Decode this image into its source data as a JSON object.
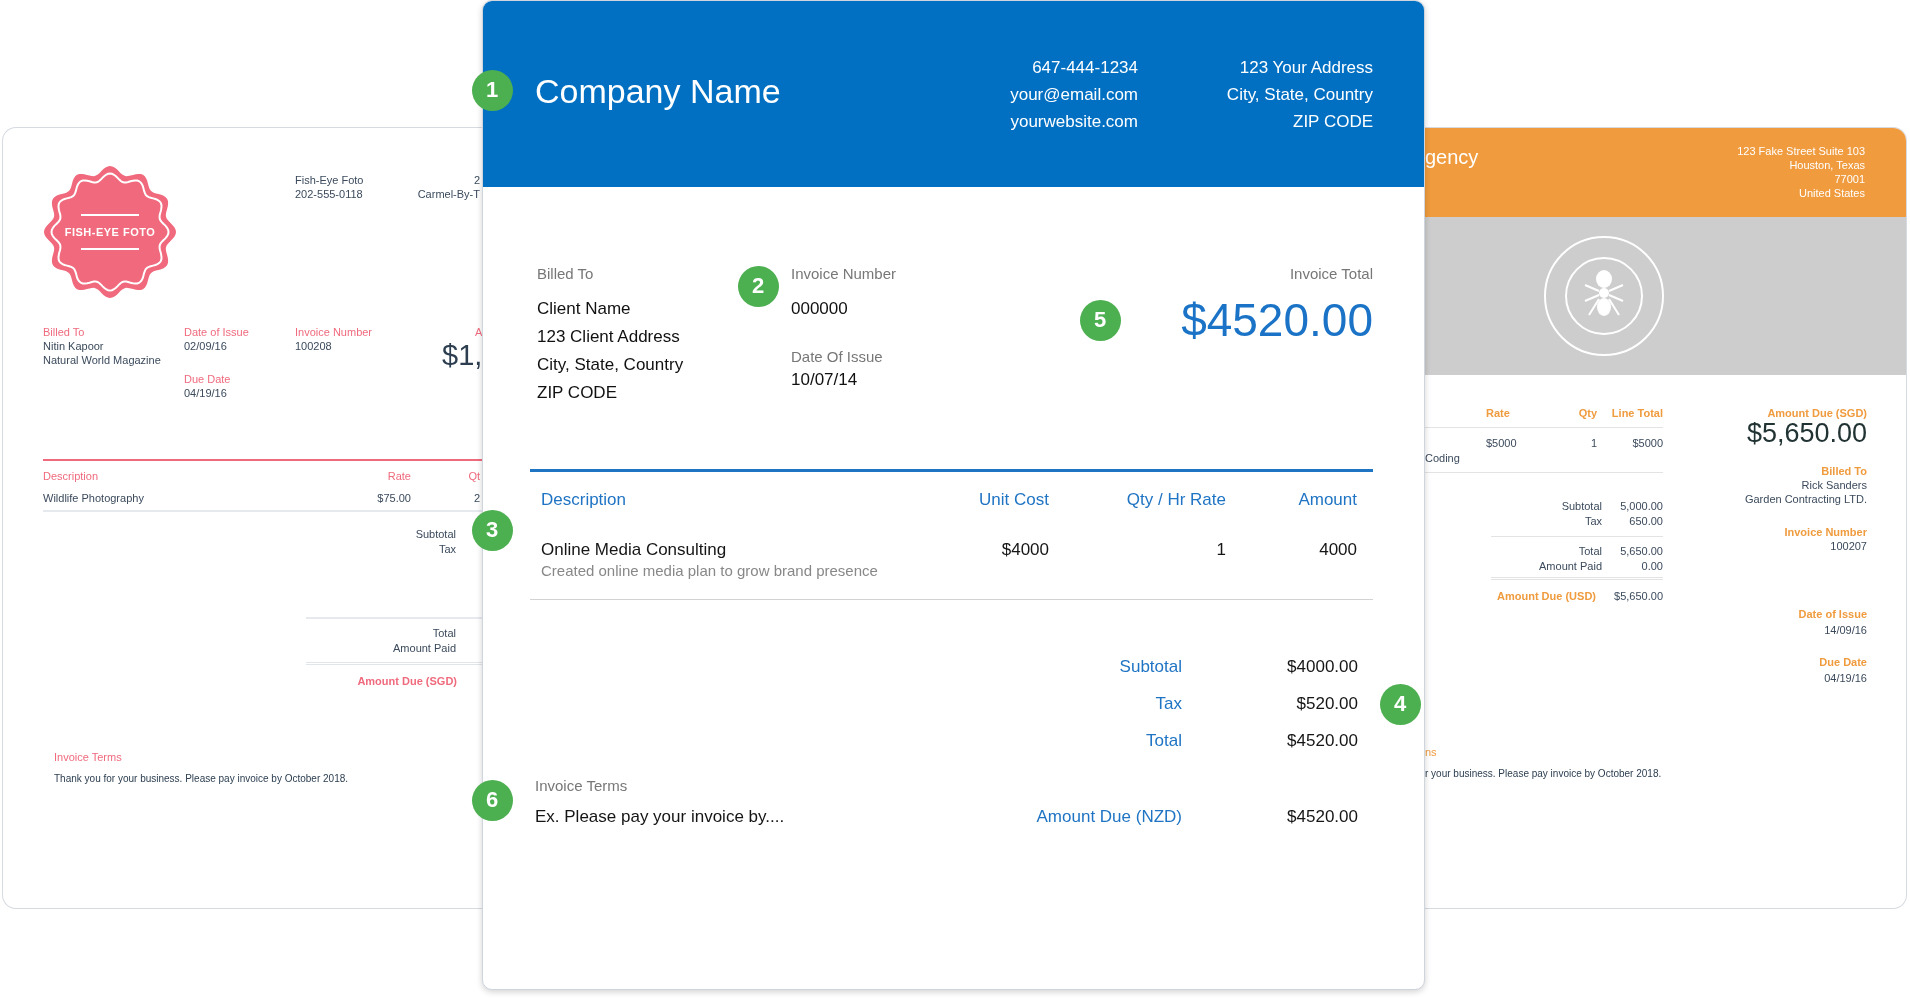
{
  "left_invoice": {
    "logo_text": "FISH-EYE FOTO",
    "contact": [
      "Fish-Eye Foto",
      "202-555-0118"
    ],
    "address": [
      "2",
      "Carmel-By-T"
    ],
    "billed_to": {
      "label": "Billed To",
      "lines": [
        "Nitin Kapoor",
        "Natural World Magazine"
      ]
    },
    "dates": [
      {
        "label": "Date of Issue",
        "value": "02/09/16"
      },
      {
        "label": "Due Date",
        "value": "04/19/16"
      }
    ],
    "invoice_number": {
      "label": "Invoice Number",
      "value": "100208"
    },
    "amount": {
      "label": "A",
      "value": "$1,"
    },
    "columns": [
      "Description",
      "Rate",
      "Qt"
    ],
    "rows": [
      [
        "Wildlife Photography",
        "$75.00",
        "2"
      ]
    ],
    "subtotals": [
      "Subtotal",
      "Tax"
    ],
    "totals": [
      "Total",
      "Amount Paid"
    ],
    "amount_due": "Amount Due (SGD)",
    "terms": {
      "label": "Invoice Terms",
      "text": "Thank you for your business. Please pay invoice by October 2018."
    }
  },
  "main_invoice": {
    "header": {
      "company": "Company Name",
      "contact": [
        "647-444-1234",
        "your@email.com",
        "yourwebsite.com"
      ],
      "address": [
        "123 Your Address",
        "City, State, Country",
        "ZIP CODE"
      ],
      "callout": "1"
    },
    "billed_to": {
      "label": "Billed To",
      "lines": [
        "Client Name",
        "123 Client Address",
        "City, State, Country",
        "ZIP CODE"
      ]
    },
    "invoice_number": {
      "label": "Invoice Number",
      "value": "000000",
      "callout": "2"
    },
    "date_of_issue": {
      "label": "Date Of Issue",
      "value": "10/07/14"
    },
    "invoice_total": {
      "label": "Invoice Total",
      "value": "$4520.00",
      "callout": "5"
    },
    "columns": [
      "Description",
      "Unit Cost",
      "Qty / Hr Rate",
      "Amount"
    ],
    "items": [
      {
        "description": "Online Media Consulting",
        "detail": "Created online media plan to grow brand presence",
        "unit_cost": "$4000",
        "qty": "1",
        "amount": "4000"
      }
    ],
    "items_callout": "3",
    "totals": [
      {
        "label": "Subtotal",
        "value": "$4000.00"
      },
      {
        "label": "Tax",
        "value": "$520.00"
      },
      {
        "label": "Total",
        "value": "$4520.00"
      }
    ],
    "totals_callout": "4",
    "terms": {
      "label": "Invoice Terms",
      "text": "Ex. Please pay your invoice by....",
      "callout": "6"
    },
    "amount_due": {
      "label": "Amount Due (NZD)",
      "value": "$4520.00"
    }
  },
  "right_invoice": {
    "header": {
      "title": "gency",
      "address": [
        "123 Fake Street Suite 103",
        "Houston, Texas",
        "77001",
        "United States"
      ]
    },
    "columns": [
      "Rate",
      "Qty",
      "Line Total"
    ],
    "rows": [
      {
        "cells": [
          "$5000",
          "1",
          "$5000"
        ],
        "detail": "Coding"
      }
    ],
    "subtotals": [
      {
        "label": "Subtotal",
        "value": "5,000.00"
      },
      {
        "label": "Tax",
        "value": "650.00"
      }
    ],
    "totals": [
      {
        "label": "Total",
        "value": "5,650.00"
      },
      {
        "label": "Amount Paid",
        "value": "0.00"
      }
    ],
    "amount_due": {
      "label": "Amount Due (USD)",
      "value": "$5,650.00"
    },
    "summary": {
      "label": "Amount Due (SGD)",
      "value": "$5,650.00"
    },
    "details": [
      {
        "label": "Billed To",
        "lines": [
          "Rick Sanders",
          "Garden Contracting LTD."
        ]
      },
      {
        "label": "Invoice Number",
        "lines": [
          "100207"
        ]
      },
      {
        "label": "Date of Issue",
        "lines": [
          "14/09/16"
        ]
      },
      {
        "label": "Due Date",
        "lines": [
          "04/19/16"
        ]
      }
    ],
    "terms": {
      "label": "ns",
      "text": "r your business. Please pay invoice by October 2018."
    }
  }
}
